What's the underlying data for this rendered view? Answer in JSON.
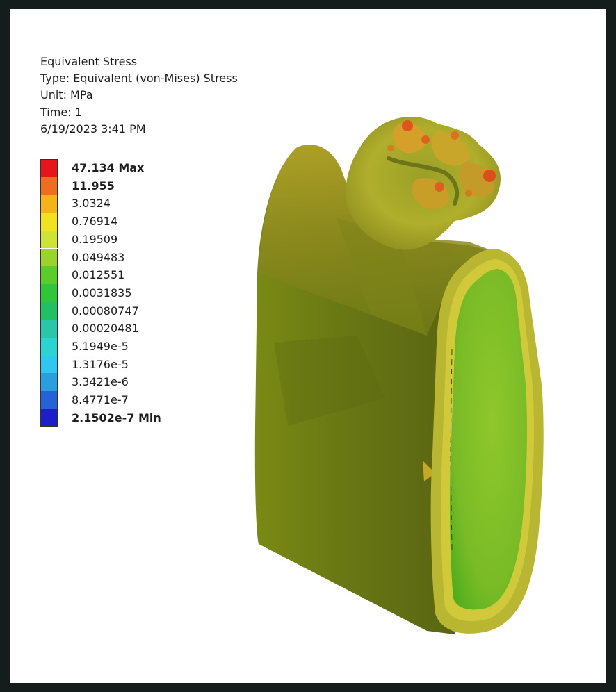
{
  "result": {
    "title": "Equivalent Stress",
    "type": "Type: Equivalent (von-Mises) Stress",
    "unit": "Unit: MPa",
    "time": "Time: 1",
    "date": "6/19/2023 3:41 PM"
  },
  "legend": [
    {
      "label": "47.134 Max",
      "color": "#e8141c",
      "bold": true
    },
    {
      "label": "11.955",
      "color": "#ef6d1f",
      "bold": true
    },
    {
      "label": "3.0324",
      "color": "#f7b21a",
      "bold": false
    },
    {
      "label": "0.76914",
      "color": "#f1e21f",
      "bold": false
    },
    {
      "label": "0.19509",
      "color": "#cde335",
      "bold": false
    },
    {
      "label": "0.049483",
      "color": "#9ad32d",
      "bold": false
    },
    {
      "label": "0.012551",
      "color": "#5bcd2b",
      "bold": false
    },
    {
      "label": "0.0031835",
      "color": "#2fc639",
      "bold": false
    },
    {
      "label": "0.00080747",
      "color": "#21c065",
      "bold": false
    },
    {
      "label": "0.00020481",
      "color": "#2ac6a8",
      "bold": false
    },
    {
      "label": "5.1949e-5",
      "color": "#2bd3d2",
      "bold": false
    },
    {
      "label": "1.3176e-5",
      "color": "#2cc8ef",
      "bold": false
    },
    {
      "label": "3.3421e-6",
      "color": "#2b9ee0",
      "bold": false
    },
    {
      "label": "8.4771e-7",
      "color": "#2661d6",
      "bold": false
    },
    {
      "label": "2.1502e-7 Min",
      "color": "#1b1ec9",
      "bold": true
    }
  ],
  "colors": {
    "frame_border": "#141c1c",
    "body_dark": "#5c6a14",
    "body_mid": "#7f8a1a",
    "section_fill": "#7fbf2a",
    "section_rim": "#c2c238",
    "crown": "#a8aa2a",
    "hotspot": "#e0481c"
  }
}
